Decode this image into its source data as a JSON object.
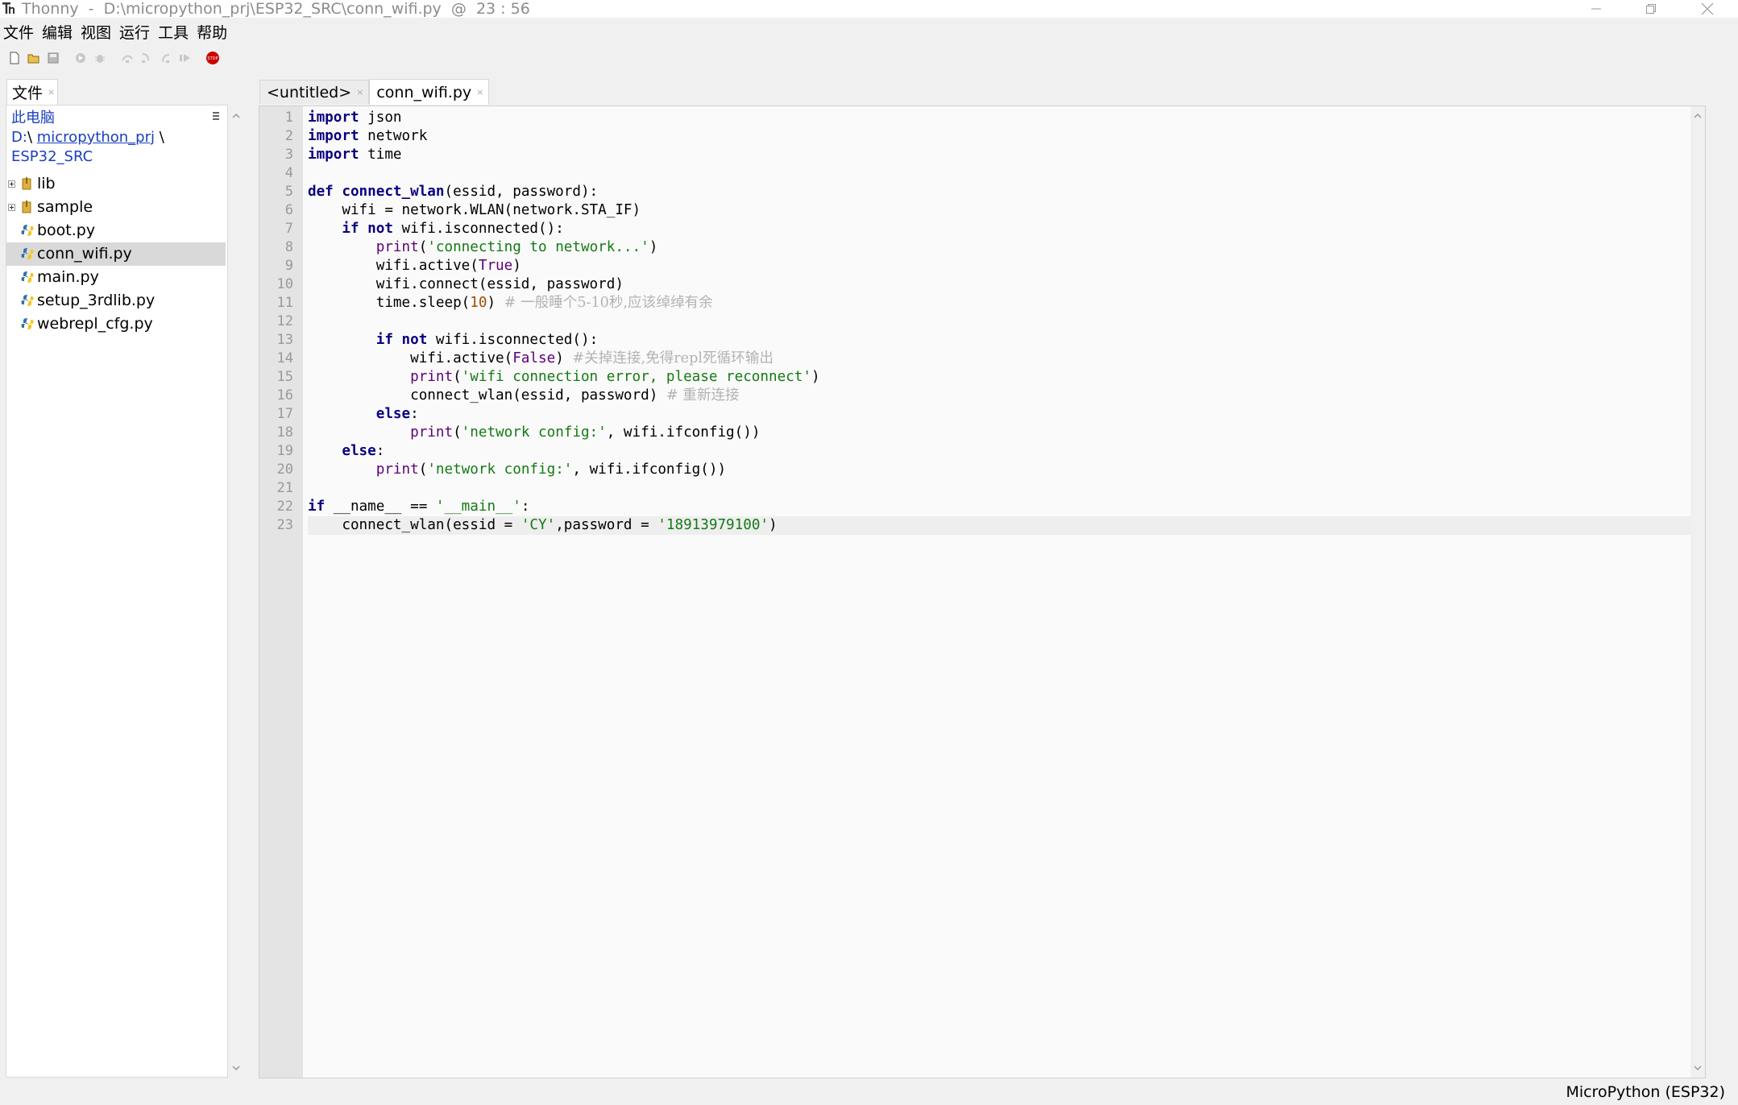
{
  "window": {
    "title": "Thonny  -  D:\\micropython_prj\\ESP32_SRC\\conn_wifi.py  @  23 : 56"
  },
  "menu": [
    "文件",
    "编辑",
    "视图",
    "运行",
    "工具",
    "帮助"
  ],
  "toolbar": {
    "icons": [
      "new-file-icon",
      "open-file-icon",
      "save-icon",
      "run-icon",
      "debug-icon",
      "step-over-icon",
      "step-into-icon",
      "step-out-icon",
      "resume-icon",
      "stop-icon"
    ],
    "stop_color": "#cc0000"
  },
  "files_panel": {
    "tab_label": "文件",
    "header": {
      "computer": "此电脑",
      "drive": "D:",
      "sep": "\\",
      "folder": "micropython_prj",
      "subfolder": "ESP32_SRC"
    },
    "items": [
      {
        "label": "lib",
        "type": "folder"
      },
      {
        "label": "sample",
        "type": "folder"
      },
      {
        "label": "boot.py",
        "type": "file"
      },
      {
        "label": "conn_wifi.py",
        "type": "file",
        "selected": true
      },
      {
        "label": "main.py",
        "type": "file"
      },
      {
        "label": "setup_3rdlib.py",
        "type": "file"
      },
      {
        "label": "webrepl_cfg.py",
        "type": "file"
      }
    ]
  },
  "editor": {
    "tabs": [
      {
        "label": "<untitled>",
        "active": false
      },
      {
        "label": "conn_wifi.py",
        "active": true
      }
    ],
    "tab_close": "×",
    "current_line": 23,
    "line_numbers": [
      "1",
      "2",
      "3",
      "4",
      "5",
      "6",
      "7",
      "8",
      "9",
      "10",
      "11",
      "12",
      "13",
      "14",
      "15",
      "16",
      "17",
      "18",
      "19",
      "20",
      "21",
      "22",
      "23"
    ],
    "code": [
      "import json",
      "import network",
      "import time",
      "",
      "def connect_wlan(essid, password):",
      "    wifi = network.WLAN(network.STA_IF)",
      "    if not wifi.isconnected():",
      "        print('connecting to network...')",
      "        wifi.active(True)",
      "        wifi.connect(essid, password)",
      "        time.sleep(10) # 一般睡个5-10秒,应该绰绰有余",
      "",
      "        if not wifi.isconnected():",
      "            wifi.active(False) #关掉连接,免得repl死循环输出",
      "            print('wifi connection error, please reconnect')",
      "            connect_wlan(essid, password) # 重新连接",
      "        else:",
      "            print('network config:', wifi.ifconfig())",
      "    else:",
      "        print('network config:', wifi.ifconfig())",
      "",
      "if __name__ == '__main__':",
      "    connect_wlan(essid = 'CY',password = '18913979100')"
    ]
  },
  "statusbar": {
    "interpreter": "MicroPython (ESP32)"
  }
}
